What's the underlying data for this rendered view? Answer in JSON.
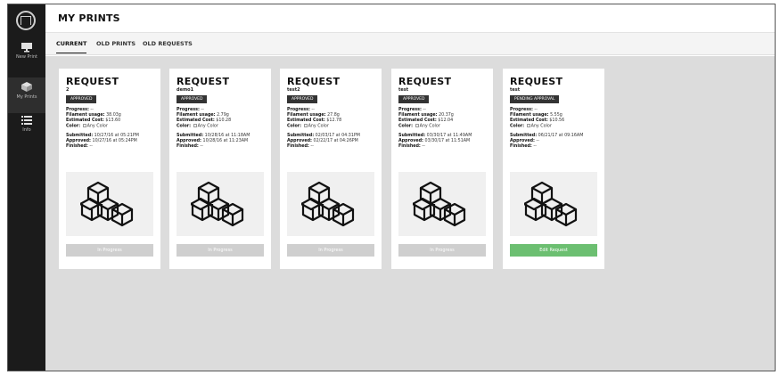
{
  "header": {
    "title": "MY PRINTS"
  },
  "sidebar": {
    "items": [
      {
        "label": "New Print",
        "icon": "monitor-icon"
      },
      {
        "label": "My Prints",
        "icon": "cube-icon"
      },
      {
        "label": "Info",
        "icon": "list-icon"
      }
    ]
  },
  "tabs": [
    {
      "label": "CURRENT"
    },
    {
      "label": "OLD PRINTS"
    },
    {
      "label": "OLD REQUESTS"
    }
  ],
  "cards": [
    {
      "title": "REQUEST",
      "name": "2",
      "status": "APPROVED",
      "progress_label": "Progress:",
      "progress": "--",
      "filament_label": "Filament usage:",
      "filament": "38.03g",
      "cost_label": "Estimated Cost:",
      "cost": "$13.60",
      "color_label": "Color:",
      "color": "Any Color",
      "submitted_label": "Submitted:",
      "submitted": "10/27/16 at 05:21PM",
      "approved_label": "Approved:",
      "approved": "10/27/16 at 05:24PM",
      "finished_label": "Finished:",
      "finished": "--",
      "button": "In Progress"
    },
    {
      "title": "REQUEST",
      "name": "demo1",
      "status": "APPROVED",
      "progress_label": "Progress:",
      "progress": "--",
      "filament_label": "Filament usage:",
      "filament": "2.79g",
      "cost_label": "Estimated Cost:",
      "cost": "$10.28",
      "color_label": "Color:",
      "color": "Any Color",
      "submitted_label": "Submitted:",
      "submitted": "10/28/16 at 11:18AM",
      "approved_label": "Approved:",
      "approved": "10/28/16 at 11:23AM",
      "finished_label": "Finished:",
      "finished": "--",
      "button": "In Progress"
    },
    {
      "title": "REQUEST",
      "name": "test2",
      "status": "APPROVED",
      "progress_label": "Progress:",
      "progress": "--",
      "filament_label": "Filament usage:",
      "filament": "27.8g",
      "cost_label": "Estimated Cost:",
      "cost": "$12.78",
      "color_label": "Color:",
      "color": "Any Color",
      "submitted_label": "Submitted:",
      "submitted": "02/03/17 at 04:31PM",
      "approved_label": "Approved:",
      "approved": "02/22/17 at 04:26PM",
      "finished_label": "Finished:",
      "finished": "--",
      "button": "In Progress"
    },
    {
      "title": "REQUEST",
      "name": "test",
      "status": "APPROVED",
      "progress_label": "Progress:",
      "progress": "--",
      "filament_label": "Filament usage:",
      "filament": "20.37g",
      "cost_label": "Estimated Cost:",
      "cost": "$12.04",
      "color_label": "Color:",
      "color": "Any Color",
      "submitted_label": "Submitted:",
      "submitted": "03/30/17 at 11:49AM",
      "approved_label": "Approved:",
      "approved": "03/30/17 at 11:51AM",
      "finished_label": "Finished:",
      "finished": "--",
      "button": "In Progress"
    },
    {
      "title": "REQUEST",
      "name": "test",
      "status": "PENDING APPROVAL",
      "progress_label": "Progress:",
      "progress": "--",
      "filament_label": "Filament usage:",
      "filament": "5.55g",
      "cost_label": "Estimated Cost:",
      "cost": "$10.56",
      "color_label": "Color:",
      "color": "Any Color",
      "submitted_label": "Submitted:",
      "submitted": "06/21/17 at 09:16AM",
      "approved_label": "Approved:",
      "approved": "--",
      "finished_label": "Finished:",
      "finished": "--",
      "button": "Edit Request"
    }
  ],
  "colors": {
    "sidebar_bg": "#1b1b1b",
    "content_bg": "#dcdcdc",
    "badge_bg": "#333333",
    "button_disabled": "#cfcfcf",
    "button_edit": "#6cbf71"
  }
}
